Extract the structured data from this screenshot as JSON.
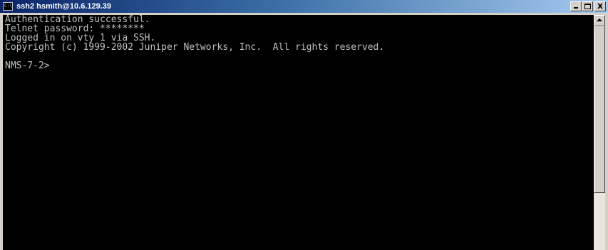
{
  "window": {
    "title": "ssh2 hsmith@10.6.129.39",
    "app_icon": "console-icon",
    "buttons": [
      "minimize-icon",
      "maximize-icon",
      "close-icon"
    ],
    "close_glyph": "x"
  },
  "console": {
    "lines": [
      "Authentication successful.",
      "Telnet password: ********",
      "Logged in on vty 1 via SSH.",
      "Copyright (c) 1999-2002 Juniper Networks, Inc.  All rights reserved.",
      "",
      "NMS-7-2>"
    ],
    "text_color": "#c0c0c0",
    "background_color": "#000000"
  },
  "colors": {
    "titlebar_start": "#0a246a",
    "titlebar_end": "#a6caf0",
    "chrome": "#d4d0c8"
  }
}
